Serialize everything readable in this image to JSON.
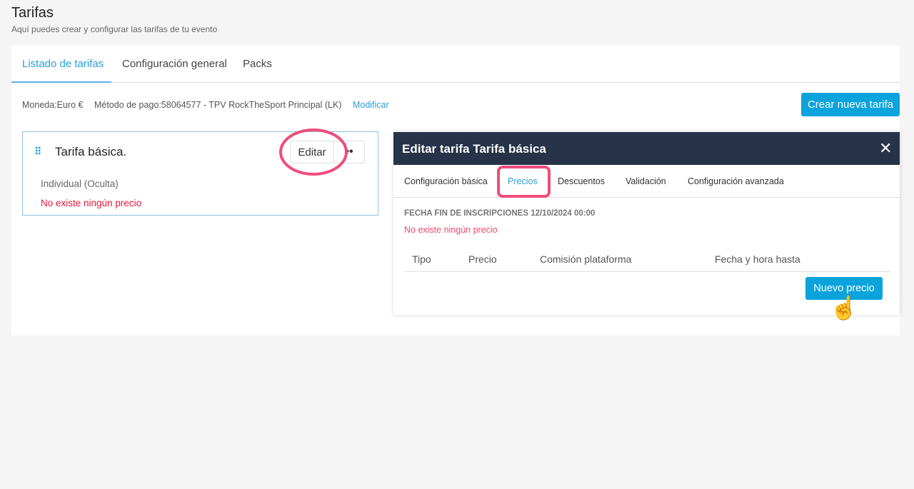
{
  "header": {
    "title": "Tarifas",
    "subtitle": "Aquí puedes crear y configurar las tarifas de tu evento"
  },
  "tabs": [
    {
      "label": "Listado de tarifas"
    },
    {
      "label": "Configuración general"
    },
    {
      "label": "Packs"
    }
  ],
  "info": {
    "currency": "Moneda:Euro €",
    "payment": "Método de pago:58064577 - TPV RockTheSport Principal (LK)",
    "modify": "Modificar"
  },
  "create_button": "Crear nueva tarifa",
  "card": {
    "drag_icon": "⠿",
    "title": "Tarifa básica.",
    "edit": "Editar",
    "more": "••",
    "type": "Individual (Oculta)",
    "no_price": "No existe ningún precio"
  },
  "modal": {
    "title": "Editar tarifa Tarifa básica",
    "close": "✕",
    "tabs": [
      {
        "label": "Configuración básica"
      },
      {
        "label": "Precios"
      },
      {
        "label": "Descuentos"
      },
      {
        "label": "Validación"
      },
      {
        "label": "Configuración avanzada"
      }
    ],
    "deadline": "FECHA FIN DE INSCRIPCIONES 12/10/2024 00:00",
    "no_price": "No existe ningún precio",
    "columns": [
      "Tipo",
      "Precio",
      "Comisión plataforma",
      "Fecha y hora hasta"
    ],
    "new_price": "Nuevo precio"
  },
  "colors": {
    "accent": "#0aa3dc",
    "highlight": "#ee4d7c",
    "modal_header": "#263349"
  }
}
